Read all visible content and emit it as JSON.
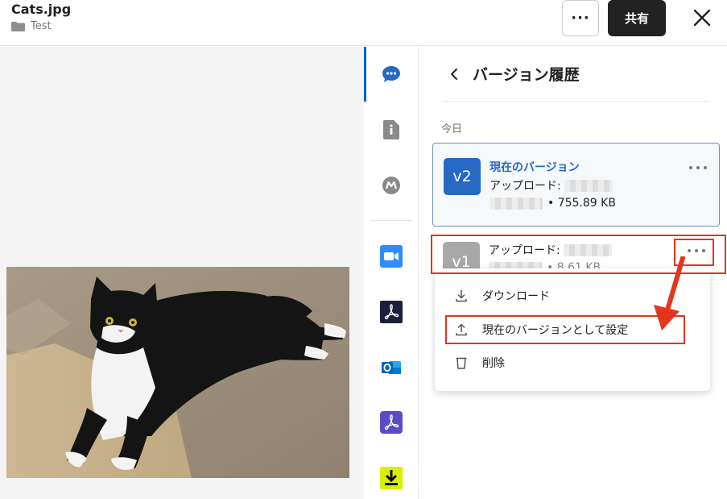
{
  "header": {
    "file_name": "Cats.jpg",
    "folder_name": "Test",
    "more_label": "···",
    "share_label": "共有"
  },
  "panel": {
    "title": "バージョン履歴",
    "date_group": "今日",
    "versions": [
      {
        "badge": "v2",
        "name": "現在のバージョン",
        "upload_prefix": "アップロード:",
        "size_text": "• 755.89 KB"
      },
      {
        "badge": "v1",
        "upload_prefix": "アップロード:",
        "size_text": "• 8.61 KB"
      }
    ]
  },
  "menu": {
    "items": [
      {
        "label": "ダウンロード",
        "icon": "download-icon"
      },
      {
        "label": "現在のバージョンとして設定",
        "icon": "upload-icon"
      },
      {
        "label": "削除",
        "icon": "trash-icon"
      }
    ]
  },
  "rail": {
    "icons": [
      "comments-icon",
      "info-icon",
      "metadata-icon",
      "zoom-icon",
      "adobe-acrobat-icon",
      "outlook-icon",
      "adobe-sign-icon",
      "download-app-icon"
    ]
  },
  "colors": {
    "accent_blue": "#2569c4",
    "annotation_red": "#e5341e",
    "share_button": "#222222"
  }
}
